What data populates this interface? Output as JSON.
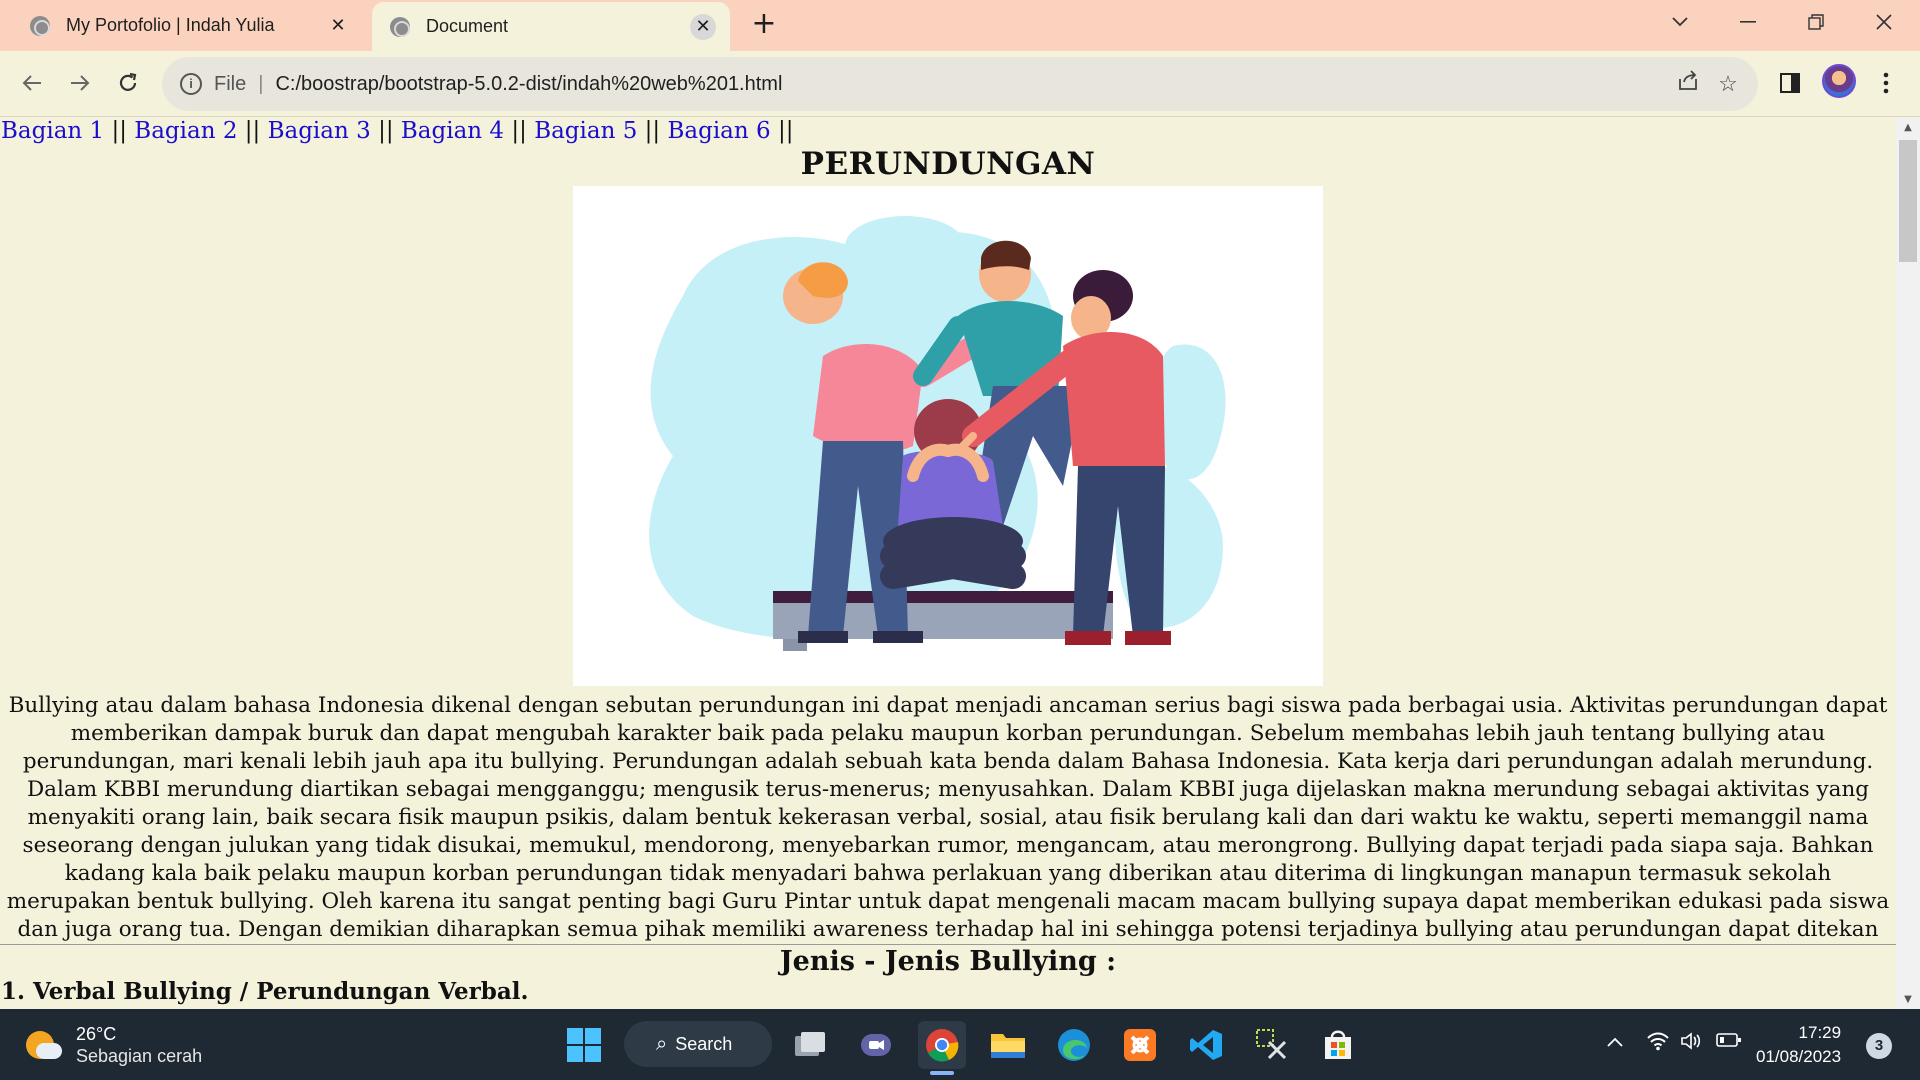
{
  "browser": {
    "tabs": [
      {
        "title": "My Portofolio | Indah Yulia",
        "close": "✕"
      },
      {
        "title": "Document",
        "close": "✕"
      }
    ],
    "new_tab": "+",
    "address": {
      "scheme_label": "File",
      "separator": "|",
      "url": "C:/boostrap/bootstrap-5.0.2-dist/indah%20web%201.html"
    }
  },
  "page": {
    "nav": {
      "links": [
        "Bagian 1",
        "Bagian 2",
        "Bagian 3",
        "Bagian 4",
        "Bagian 5",
        "Bagian 6"
      ],
      "separator": "||"
    },
    "heading": "PERUNDUNGAN",
    "paragraph": "Bullying atau dalam bahasa Indonesia dikenal dengan sebutan perundungan ini dapat menjadi ancaman serius bagi siswa pada berbagai usia. Aktivitas perundungan dapat memberikan dampak buruk dan dapat mengubah karakter baik pada pelaku maupun korban perundungan. Sebelum membahas lebih jauh tentang bullying atau perundungan, mari kenali lebih jauh apa itu bullying. Perundungan adalah sebuah kata benda dalam Bahasa Indonesia. Kata kerja dari perundungan adalah merundung. Dalam KBBI merundung diartikan sebagai mengganggu; mengusik terus-menerus; menyusahkan. Dalam KBBI juga dijelaskan makna merundung sebagai aktivitas yang menyakiti orang lain, baik secara fisik maupun psikis, dalam bentuk kekerasan verbal, sosial, atau fisik berulang kali dan dari waktu ke waktu, seperti memanggil nama seseorang dengan julukan yang tidak disukai, memukul, mendorong, menyebarkan rumor, mengancam, atau merongrong. Bullying dapat terjadi pada siapa saja. Bahkan kadang kala baik pelaku maupun korban perundungan tidak menyadari bahwa perlakuan yang diberikan atau diterima di lingkungan manapun termasuk sekolah merupakan bentuk bullying. Oleh karena itu sangat penting bagi Guru Pintar untuk dapat mengenali macam macam bullying supaya dapat memberikan edukasi pada siswa dan juga orang tua. Dengan demikian diharapkan semua pihak memiliki awareness terhadap hal ini sehingga potensi terjadinya bullying atau perundungan dapat ditekan",
    "subheading": "Jenis - Jenis Bullying :",
    "point1": "1. Verbal Bullying / Perundungan Verbal."
  },
  "taskbar": {
    "weather": {
      "temp": "26°C",
      "condition": "Sebagian cerah"
    },
    "search_label": "Search",
    "clock": {
      "time": "17:29",
      "date": "01/08/2023"
    },
    "notification_count": "3"
  },
  "colors": {
    "tabstrip": "#fbd2bd",
    "page_bg": "#f5f2dc",
    "link": "#1a0dcc",
    "taskbar": "#1f2933"
  }
}
